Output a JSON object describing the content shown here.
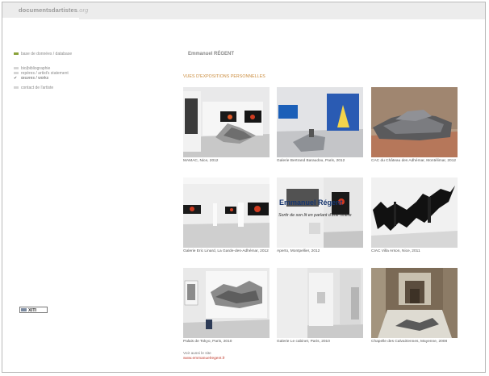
{
  "header": {
    "site_name": "documentsdartistes",
    "site_ext": ".org"
  },
  "nav": {
    "items": [
      {
        "label": "base de données / database",
        "bullet": "green"
      },
      {
        "label": "bio|bibliographie",
        "bullet": "gray"
      },
      {
        "label": "repères / artist's statement",
        "bullet": "gray"
      },
      {
        "label": "œuvres / works",
        "bullet": "check"
      },
      {
        "label": "contact de l'artiste",
        "bullet": "gray"
      }
    ]
  },
  "badge": {
    "label": "XITI"
  },
  "main": {
    "artist_name": "Emmanuel RÉGENT",
    "section_title": "VUES D'EXPOSITIONS PERSONNELLES",
    "overlay_title": "Emmanuel Régent",
    "overlay_subtitle": "Sortir de son lit en parlant d'une rivière",
    "exhibitions": [
      {
        "caption": "MAMAC, Nice, 2012"
      },
      {
        "caption": "Galerie Bertrand Baraudou, Paris, 2012"
      },
      {
        "caption": "CAC du Château des Adhémar, Montélimar, 2012"
      },
      {
        "caption": "Galerie Eric Linard, La Garde-des-Adhémar, 2012"
      },
      {
        "caption": "Aperto, Montpellier, 2012"
      },
      {
        "caption": "CIAC Villa Arson, Nice, 2011"
      },
      {
        "caption": "Palais de Tokyo, Paris, 2010"
      },
      {
        "caption": "Galerie Le cabinet, Paris, 2010"
      },
      {
        "caption": "Chapelle des Calvairiennes, Mayenne, 2008"
      }
    ],
    "see_also": "Voir aussi le site",
    "website": "www.emmanuelregent.fr"
  }
}
